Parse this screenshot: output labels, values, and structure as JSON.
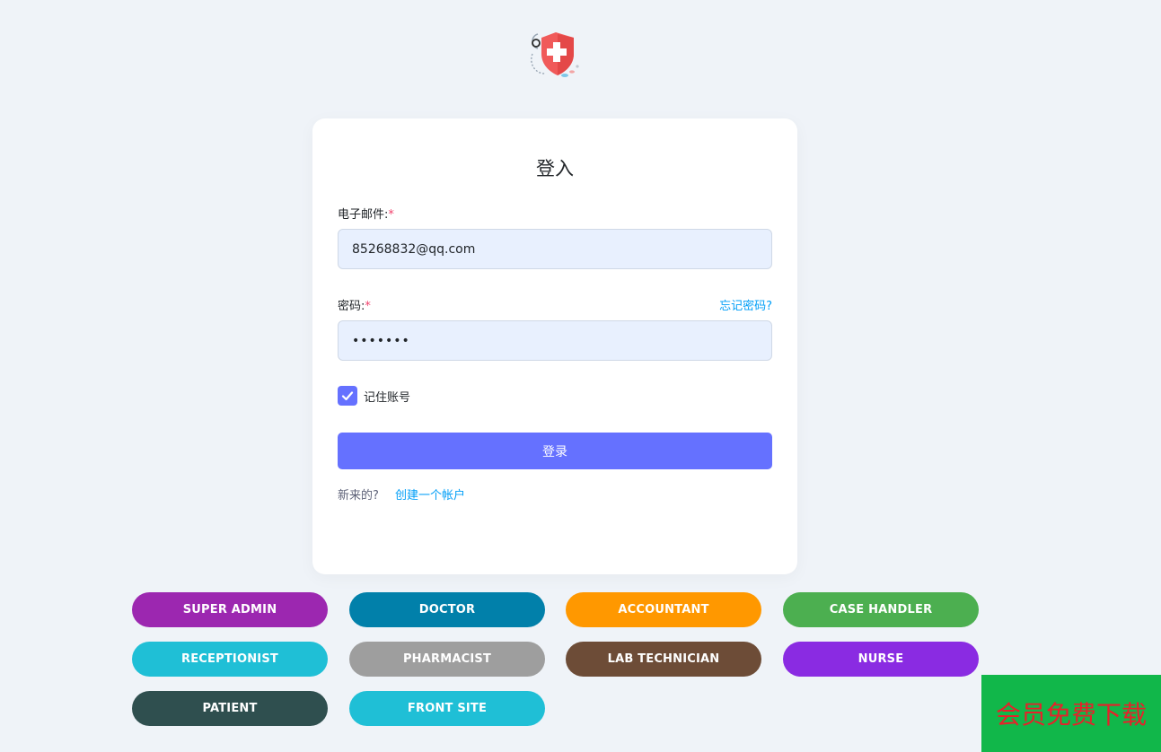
{
  "login": {
    "title": "登入",
    "email_label": "电子邮件:",
    "email_value": "85268832@qq.com",
    "password_label": "密码:",
    "password_value": "•••••••",
    "required_mark": "*",
    "forgot_link": "忘记密码?",
    "remember_label": "记住账号",
    "remember_checked": true,
    "submit_label": "登录",
    "new_text": "新来的?",
    "create_link": "创建一个帐户"
  },
  "roles": [
    {
      "label": "SUPER ADMIN",
      "color": "#9c27b0"
    },
    {
      "label": "DOCTOR",
      "color": "#0180aa"
    },
    {
      "label": "ACCOUNTANT",
      "color": "#ff9800"
    },
    {
      "label": "CASE HANDLER",
      "color": "#4caf50"
    },
    {
      "label": "RECEPTIONIST",
      "color": "#1fbfd6"
    },
    {
      "label": "PHARMACIST",
      "color": "#9e9e9e"
    },
    {
      "label": "LAB TECHNICIAN",
      "color": "#6d4c37"
    },
    {
      "label": "NURSE",
      "color": "#8a2be2"
    },
    {
      "label": "PATIENT",
      "color": "#2f4f4f"
    },
    {
      "label": "FRONT SITE",
      "color": "#1fbfd6"
    }
  ],
  "banner": {
    "text": "会员免费下载",
    "bg_color": "#11b74a",
    "text_color": "#e8202a"
  },
  "colors": {
    "primary": "#6571ff",
    "link": "#009ef7",
    "required": "#f1416c",
    "page_bg": "#eff3f8"
  },
  "icons": {
    "logo": "medical-shield-logo",
    "checkbox": "check-icon"
  }
}
